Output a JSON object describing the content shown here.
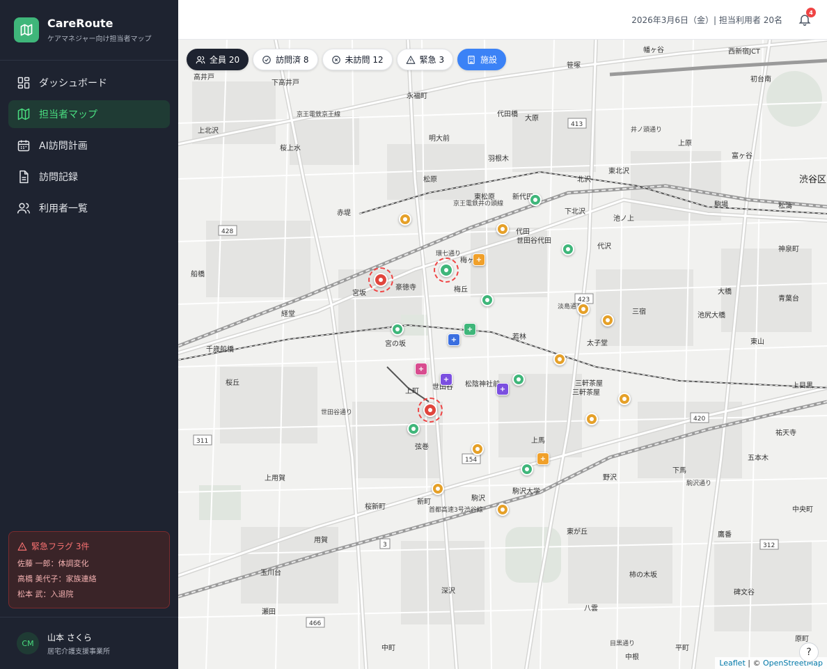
{
  "brand": {
    "name": "CareRoute",
    "subtitle": "ケアマネジャー向け担当者マップ"
  },
  "nav": [
    {
      "label": "ダッシュボード",
      "icon": "dashboard-icon",
      "active": false
    },
    {
      "label": "担当者マップ",
      "icon": "map-icon",
      "active": true
    },
    {
      "label": "AI訪問計画",
      "icon": "calendar-icon",
      "active": false
    },
    {
      "label": "訪問記録",
      "icon": "document-icon",
      "active": false
    },
    {
      "label": "利用者一覧",
      "icon": "users-icon",
      "active": false
    }
  ],
  "alerts": {
    "title": "緊急フラグ 3件",
    "items": [
      "佐藤 一郎：体調変化",
      "高橋 美代子：家族連絡",
      "松本 武：入退院"
    ]
  },
  "user": {
    "initials": "CM",
    "name": "山本 さくら",
    "org": "居宅介護支援事業所"
  },
  "topbar": {
    "info": "2026年3月6日（金）| 担当利用者 20名",
    "notifications": "4"
  },
  "filters": [
    {
      "label": "全員 20",
      "icon": "users-icon",
      "style": "dark"
    },
    {
      "label": "訪問済 8",
      "icon": "check-circle-icon",
      "style": "light"
    },
    {
      "label": "未訪問 12",
      "icon": "x-circle-icon",
      "style": "light"
    },
    {
      "label": "緊急 3",
      "icon": "warning-icon",
      "style": "light"
    },
    {
      "label": "施設",
      "icon": "building-icon",
      "style": "blue"
    }
  ],
  "map": {
    "labels": [
      "高井戸",
      "下高井戸",
      "永福町",
      "代田橋",
      "大原",
      "笹塚",
      "幡ヶ谷",
      "西新宿JCT",
      "初台南",
      "上北沢",
      "桜上水",
      "明大前",
      "羽根木",
      "井ノ頭通り",
      "上原",
      "富ヶ谷",
      "渋谷区",
      "赤堤",
      "松原",
      "東松原",
      "新代田",
      "北沢",
      "東北沢",
      "下北沢",
      "池ノ上",
      "駒場",
      "松濤",
      "代田",
      "世田谷代田",
      "梅ヶ丘",
      "代沢",
      "神泉町",
      "宮坂",
      "豪徳寺",
      "経堂",
      "梅丘",
      "淡島通り",
      "三宿",
      "池尻大橋",
      "大橋",
      "青葉台",
      "船橋",
      "宮の坂",
      "若林",
      "太子堂",
      "三軒茶屋",
      "東山",
      "上目黒",
      "千歳船橋",
      "桜丘",
      "世田谷",
      "松陰神社前",
      "上町",
      "三軒茶屋",
      "弦巻",
      "上馬",
      "祐天寺",
      "五本木",
      "野沢",
      "下馬",
      "上用賀",
      "新町",
      "駒沢",
      "駒沢大学",
      "中央町",
      "用賀",
      "桜新町",
      "東が丘",
      "鷹番",
      "碑文谷",
      "玉川台",
      "深沢",
      "柿の木坂",
      "八雲",
      "瀬田",
      "中町",
      "平町",
      "中根",
      "原町",
      "世田谷通り",
      "環七通り",
      "首都高速3号渋谷線",
      "京王電鉄井の頭線",
      "京王電鉄京王線",
      "目黒通り",
      "駒沢通り"
    ],
    "attribution_leaflet": "Leaflet",
    "attribution_sep": " | © ",
    "attribution_osm": "OpenStreetMap",
    "help": "?"
  },
  "colors": {
    "visited": "#3fb67a",
    "pending": "#e5a028",
    "urgent": "#e0453d",
    "facility_orange": "#f0a02a",
    "facility_green": "#3fb67a",
    "facility_blue": "#3b6fe0",
    "facility_purple": "#7b4fe0",
    "facility_pink": "#d84c8f"
  }
}
